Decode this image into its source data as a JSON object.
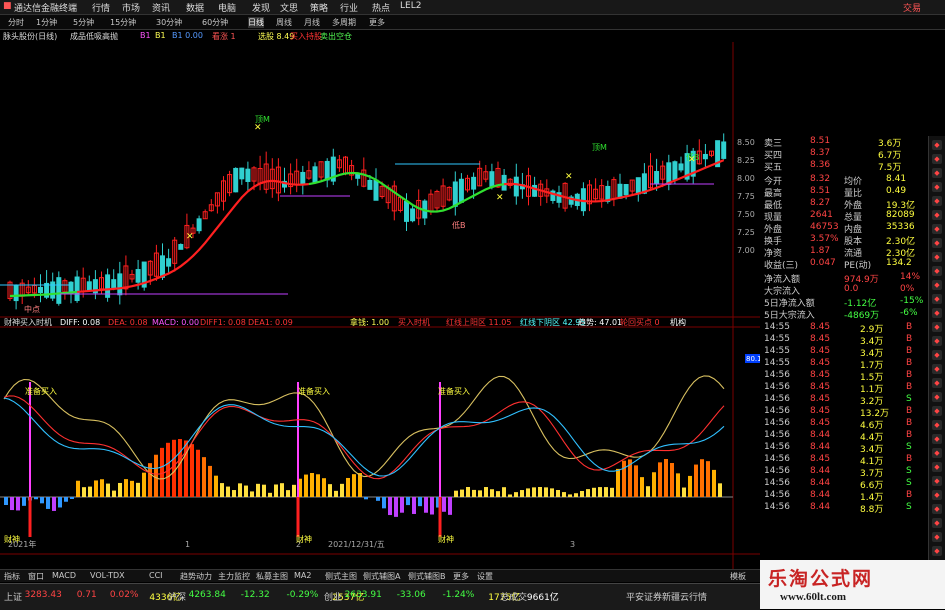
{
  "titlebar": {
    "app_name": "通达信金融终端",
    "menus": [
      "行情",
      "市场",
      "资讯",
      "数据",
      "电脑",
      "发现",
      "文思",
      "策略",
      "行业",
      "热点",
      "LEL2"
    ],
    "right_label": "交易"
  },
  "toolbar": {
    "periods": [
      "分时",
      "1分钟",
      "5分钟",
      "15分钟",
      "30分钟",
      "60分钟",
      "日线",
      "周线",
      "月线",
      "多周期",
      "更多"
    ],
    "active_period": "日线"
  },
  "infobar": {
    "stock": "脉头股份(日线)",
    "formula": "成品低吸高抛",
    "items": [
      {
        "text": "B1",
        "color": "#ff55ff"
      },
      {
        "text": "B1",
        "color": "#ffff55"
      },
      {
        "text": "B1 0.00",
        "color": "#5599ff"
      },
      {
        "text": "看涨 1",
        "color": "#ff5555"
      },
      {
        "text": "选股 8.49",
        "color": "#ffff55"
      },
      {
        "text": "买入持股",
        "color": "#ff3333"
      },
      {
        "text": "卖出空仓",
        "color": "#55ff55"
      }
    ]
  },
  "price_axis": [
    "8.50",
    "8.25",
    "8.00",
    "7.75",
    "7.50",
    "7.25",
    "7.00"
  ],
  "chart_labels": {
    "top_mark": "顶M",
    "mid_mark": "顶M",
    "low_mark": "低B",
    "bottom_mark": "中点",
    "bottom_mark2": "低B",
    "x_dates": [
      "2021年",
      "1",
      "2",
      "2021/12/31/五",
      "3"
    ],
    "sub_marks": [
      "准备买入",
      "准备买入",
      "准备买入"
    ],
    "sub_bottom": [
      "财神",
      "财神",
      "财神"
    ]
  },
  "subchart_info": {
    "name": "财神买入时机",
    "items": [
      {
        "text": "DIFF: 0.08",
        "color": "#ffffff"
      },
      {
        "text": "DEA: 0.08",
        "color": "#ff3333"
      },
      {
        "text": "MACD: 0.00",
        "color": "#ff55ff"
      },
      {
        "text": "DIFF1: 0.08",
        "color": "#ff3333"
      },
      {
        "text": "DEA1: 0.09",
        "color": "#ff3333"
      },
      {
        "text": "拿钱: 1.00",
        "color": "#ffff55"
      },
      {
        "text": "买入时机",
        "color": "#ff3333"
      },
      {
        "text": "红线上阳区 11.05",
        "color": "#ff3333"
      },
      {
        "text": "红线下阴区 42.95",
        "color": "#55ffff"
      },
      {
        "text": "趋势: 47.01",
        "color": "#ffffff"
      },
      {
        "text": "轮回买点 0",
        "color": "#ff3333"
      },
      {
        "text": "机构",
        "color": "#ffffff"
      }
    ],
    "axis_value": "80.11"
  },
  "quote_panel": {
    "asks": [
      {
        "label": "卖三",
        "price": "8.51",
        "vol": "3.6万"
      },
      {
        "label": "买四",
        "price": "8.37",
        "vol": "6.7万"
      },
      {
        "label": "买五",
        "price": "8.36",
        "vol": "7.5万"
      }
    ],
    "stats": [
      {
        "l1": "今开",
        "v1": "8.32",
        "l2": "均价",
        "v2": "8.41"
      },
      {
        "l1": "最高",
        "v1": "8.51",
        "l2": "量比",
        "v2": "0.49"
      },
      {
        "l1": "最低",
        "v1": "8.27",
        "l2": "外盘",
        "v2": "19.3亿"
      },
      {
        "l1": "现量",
        "v1": "2641",
        "l2": "总量",
        "v2": "82089"
      },
      {
        "l1": "外盘",
        "v1": "46753",
        "l2": "内盘",
        "v2": "35336"
      },
      {
        "l1": "换手",
        "v1": "3.57%",
        "l2": "股本",
        "v2": "2.30亿"
      },
      {
        "l1": "净资",
        "v1": "1.87",
        "l2": "流通",
        "v2": "2.30亿"
      },
      {
        "l1": "收益(三)",
        "v1": "0.047",
        "l2": "PE(动)",
        "v2": "134.2"
      }
    ],
    "flows": [
      {
        "label": "净流入额",
        "value": "974.9万",
        "pct": "14%"
      },
      {
        "label": "大宗流入",
        "value": "0.0",
        "pct": "0%"
      },
      {
        "label": "5日净流入额",
        "value": "-1.12亿",
        "pct": "-15%"
      },
      {
        "label": "5日大宗流入",
        "value": "-4869万",
        "pct": "-6%"
      }
    ],
    "ticks": [
      {
        "t": "14:55",
        "p": "8.45",
        "v": "2.9万",
        "s": "B"
      },
      {
        "t": "14:55",
        "p": "8.45",
        "v": "3.4万",
        "s": "B"
      },
      {
        "t": "14:55",
        "p": "8.45",
        "v": "3.4万",
        "s": "B"
      },
      {
        "t": "14:55",
        "p": "8.45",
        "v": "1.7万",
        "s": "B"
      },
      {
        "t": "14:56",
        "p": "8.45",
        "v": "1.5万",
        "s": "B"
      },
      {
        "t": "14:56",
        "p": "8.45",
        "v": "1.1万",
        "s": "B"
      },
      {
        "t": "14:56",
        "p": "8.45",
        "v": "3.2万",
        "s": "S"
      },
      {
        "t": "14:56",
        "p": "8.45",
        "v": "13.2万",
        "s": "B"
      },
      {
        "t": "14:56",
        "p": "8.45",
        "v": "4.6万",
        "s": "B"
      },
      {
        "t": "14:56",
        "p": "8.44",
        "v": "4.4万",
        "s": "B"
      },
      {
        "t": "14:56",
        "p": "8.44",
        "v": "3.4万",
        "s": "S"
      },
      {
        "t": "14:56",
        "p": "8.45",
        "v": "4.1万",
        "s": "B"
      },
      {
        "t": "14:56",
        "p": "8.44",
        "v": "3.7万",
        "s": "S"
      },
      {
        "t": "14:56",
        "p": "8.44",
        "v": "6.6万",
        "s": "S"
      },
      {
        "t": "14:56",
        "p": "8.44",
        "v": "1.4万",
        "s": "B"
      },
      {
        "t": "14:56",
        "p": "8.44",
        "v": "8.8万",
        "s": "S"
      }
    ]
  },
  "bottom_tabs": [
    "指标",
    "窗口",
    "MACD",
    "VOL-TDX",
    "CCI",
    "趋势动力",
    "主力监控",
    "私募主图",
    "MA2",
    "侧式主图",
    "侧式辅图A",
    "侧式辅图B",
    "更多",
    "设置"
  ],
  "bottom_tabs_right": "模板",
  "index_bar": [
    {
      "name": "上证",
      "value": "3283.43",
      "chg": "0.71",
      "pct": "0.02%",
      "amt": "4336亿",
      "color": "#ff4444"
    },
    {
      "name": "沪深",
      "value": "4263.84",
      "chg": "-12.32",
      "pct": "-0.29%",
      "amt": "2537亿",
      "color": "#44ff44"
    },
    {
      "name": "创业",
      "value": "2633.91",
      "chg": "-33.06",
      "pct": "-1.24%",
      "amt": "1775亿",
      "color": "#44ff44"
    },
    {
      "name": "总成交",
      "value": "9661亿",
      "chg": "",
      "pct": "",
      "amt": "",
      "color": "#ffffff"
    }
  ],
  "index_bar_right": "平安证券新疆云行情",
  "watermark": {
    "title": "乐淘公式网",
    "url": "www.60lt.com"
  }
}
